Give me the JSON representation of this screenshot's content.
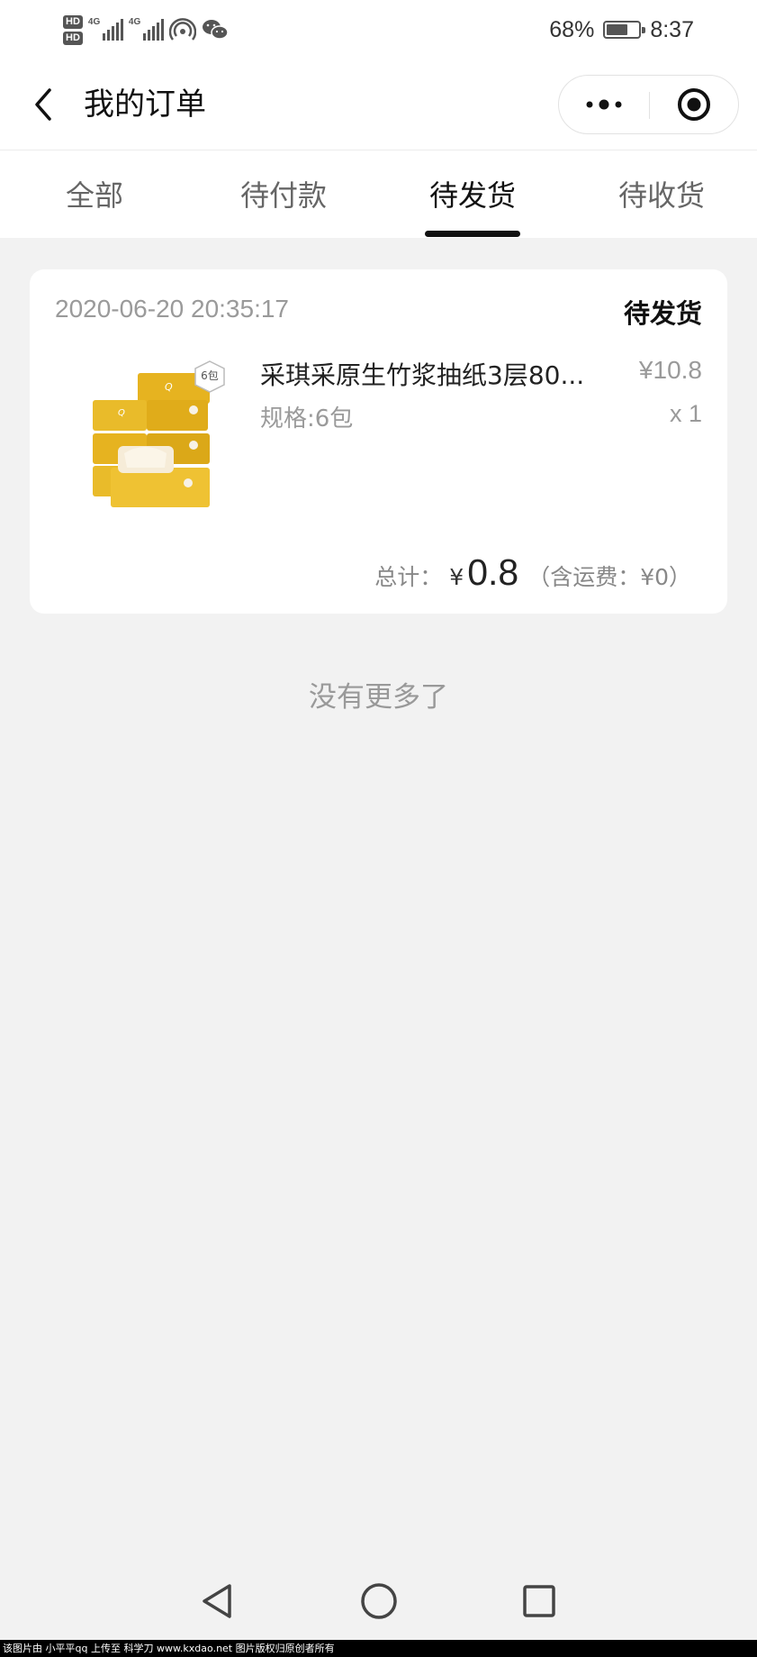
{
  "status_bar": {
    "hd1": "HD",
    "hd2": "HD",
    "net1": "4G",
    "net2": "4G",
    "battery_percent": "68%",
    "time": "8:37",
    "battery_level": 0.68
  },
  "nav": {
    "title": "我的订单"
  },
  "tabs": [
    {
      "label": "全部",
      "active": false
    },
    {
      "label": "待付款",
      "active": false
    },
    {
      "label": "待发货",
      "active": true
    },
    {
      "label": "待收货",
      "active": false
    }
  ],
  "order": {
    "time": "2020-06-20 20:35:17",
    "status": "待发货",
    "product_name": "采琪采原生竹浆抽纸3层80...",
    "price": "¥10.8",
    "spec": "规格:6包",
    "quantity": "x 1",
    "image_badge": "6包",
    "total_label": "总计：",
    "total_currency": "¥",
    "total_amount": "0.8",
    "total_shipping": "（含运费：¥0）"
  },
  "footer": {
    "no_more": "没有更多了"
  },
  "watermark": "该图片由 小平平qq 上传至 科学刀 www.kxdao.net 图片版权归原创者所有",
  "colors": {
    "background": "#f2f2f2",
    "product_yellow": "#e6b320",
    "text_muted": "#9a9a9a"
  }
}
